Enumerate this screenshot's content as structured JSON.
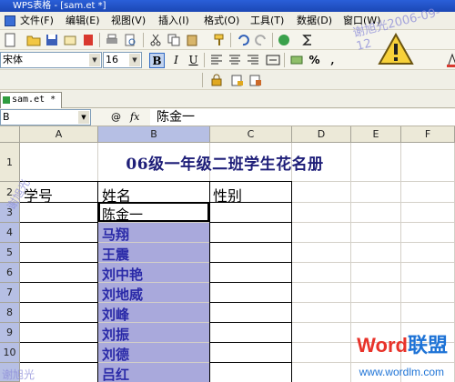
{
  "window": {
    "title": "WPS表格 - [sam.et *]"
  },
  "menu": {
    "items": [
      {
        "label": "文件(F)"
      },
      {
        "label": "编辑(E)"
      },
      {
        "label": "视图(V)"
      },
      {
        "label": "插入(I)"
      },
      {
        "label": "格式(O)"
      },
      {
        "label": "工具(T)"
      },
      {
        "label": "数据(D)"
      },
      {
        "label": "窗口(W)"
      }
    ]
  },
  "format_bar": {
    "font": "宋体",
    "size": "16",
    "bold": "B",
    "italic": "I",
    "underline": "U",
    "percent": "%"
  },
  "doc_tab": {
    "label": "sam.et *"
  },
  "formula_bar": {
    "name_box": "B",
    "fx": "fx",
    "content": "陈金一"
  },
  "grid": {
    "columns": [
      "A",
      "B",
      "C",
      "D",
      "E",
      "F"
    ],
    "rows": [
      "1",
      "2",
      "3",
      "4",
      "5",
      "6",
      "7",
      "8",
      "9",
      "10"
    ],
    "title": "06级一年级二班学生花名册",
    "headers": {
      "a": "学号",
      "b": "姓名",
      "c": "性别"
    },
    "names": [
      "陈金一",
      "马翔",
      "王震",
      "刘中艳",
      "刘地威",
      "刘峰",
      "刘振",
      "刘德",
      "吕红"
    ]
  },
  "watermarks": {
    "top": "谢旭光2006-09-12",
    "left": "谢旭光",
    "bottom_left": "谢旭光"
  },
  "brand": {
    "word": "Word",
    "suffix": "联盟",
    "url": "www.wordlm.com"
  },
  "colors": {
    "selection": "#a9a9dc",
    "name_text": "#2a2aa8",
    "title_text": "#1e1e78",
    "title_bar": "#2a5fd8"
  }
}
